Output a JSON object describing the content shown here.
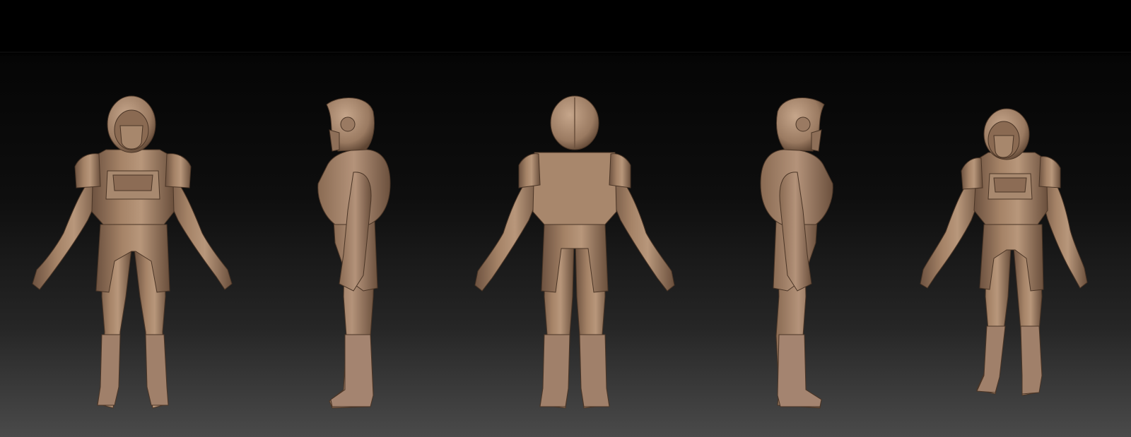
{
  "scene": {
    "colors": {
      "background_top": "#000000",
      "background_bottom": "#4a4a4a",
      "clay_light": "#b7977c",
      "clay_base": "#9e7d63",
      "clay_shadow": "#5f4634",
      "clay_highlight": "#d6b89b"
    },
    "views": [
      {
        "name": "front"
      },
      {
        "name": "right-side"
      },
      {
        "name": "back"
      },
      {
        "name": "left-side"
      },
      {
        "name": "three-quarter"
      }
    ]
  }
}
